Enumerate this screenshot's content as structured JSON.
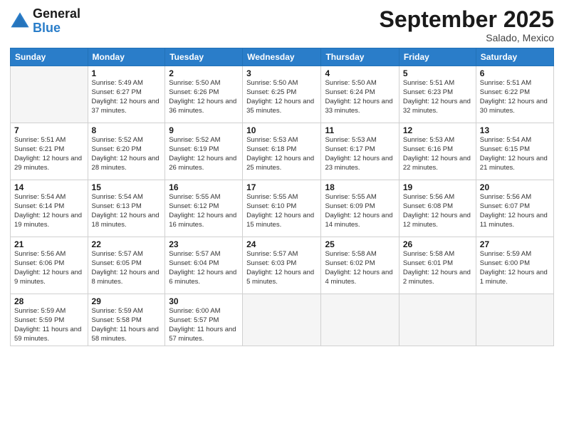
{
  "header": {
    "logo_general": "General",
    "logo_blue": "Blue",
    "month_title": "September 2025",
    "subtitle": "Salado, Mexico"
  },
  "weekdays": [
    "Sunday",
    "Monday",
    "Tuesday",
    "Wednesday",
    "Thursday",
    "Friday",
    "Saturday"
  ],
  "weeks": [
    [
      {
        "day": "",
        "info": ""
      },
      {
        "day": "1",
        "info": "Sunrise: 5:49 AM\nSunset: 6:27 PM\nDaylight: 12 hours\nand 37 minutes."
      },
      {
        "day": "2",
        "info": "Sunrise: 5:50 AM\nSunset: 6:26 PM\nDaylight: 12 hours\nand 36 minutes."
      },
      {
        "day": "3",
        "info": "Sunrise: 5:50 AM\nSunset: 6:25 PM\nDaylight: 12 hours\nand 35 minutes."
      },
      {
        "day": "4",
        "info": "Sunrise: 5:50 AM\nSunset: 6:24 PM\nDaylight: 12 hours\nand 33 minutes."
      },
      {
        "day": "5",
        "info": "Sunrise: 5:51 AM\nSunset: 6:23 PM\nDaylight: 12 hours\nand 32 minutes."
      },
      {
        "day": "6",
        "info": "Sunrise: 5:51 AM\nSunset: 6:22 PM\nDaylight: 12 hours\nand 30 minutes."
      }
    ],
    [
      {
        "day": "7",
        "info": "Sunrise: 5:51 AM\nSunset: 6:21 PM\nDaylight: 12 hours\nand 29 minutes."
      },
      {
        "day": "8",
        "info": "Sunrise: 5:52 AM\nSunset: 6:20 PM\nDaylight: 12 hours\nand 28 minutes."
      },
      {
        "day": "9",
        "info": "Sunrise: 5:52 AM\nSunset: 6:19 PM\nDaylight: 12 hours\nand 26 minutes."
      },
      {
        "day": "10",
        "info": "Sunrise: 5:53 AM\nSunset: 6:18 PM\nDaylight: 12 hours\nand 25 minutes."
      },
      {
        "day": "11",
        "info": "Sunrise: 5:53 AM\nSunset: 6:17 PM\nDaylight: 12 hours\nand 23 minutes."
      },
      {
        "day": "12",
        "info": "Sunrise: 5:53 AM\nSunset: 6:16 PM\nDaylight: 12 hours\nand 22 minutes."
      },
      {
        "day": "13",
        "info": "Sunrise: 5:54 AM\nSunset: 6:15 PM\nDaylight: 12 hours\nand 21 minutes."
      }
    ],
    [
      {
        "day": "14",
        "info": "Sunrise: 5:54 AM\nSunset: 6:14 PM\nDaylight: 12 hours\nand 19 minutes."
      },
      {
        "day": "15",
        "info": "Sunrise: 5:54 AM\nSunset: 6:13 PM\nDaylight: 12 hours\nand 18 minutes."
      },
      {
        "day": "16",
        "info": "Sunrise: 5:55 AM\nSunset: 6:12 PM\nDaylight: 12 hours\nand 16 minutes."
      },
      {
        "day": "17",
        "info": "Sunrise: 5:55 AM\nSunset: 6:10 PM\nDaylight: 12 hours\nand 15 minutes."
      },
      {
        "day": "18",
        "info": "Sunrise: 5:55 AM\nSunset: 6:09 PM\nDaylight: 12 hours\nand 14 minutes."
      },
      {
        "day": "19",
        "info": "Sunrise: 5:56 AM\nSunset: 6:08 PM\nDaylight: 12 hours\nand 12 minutes."
      },
      {
        "day": "20",
        "info": "Sunrise: 5:56 AM\nSunset: 6:07 PM\nDaylight: 12 hours\nand 11 minutes."
      }
    ],
    [
      {
        "day": "21",
        "info": "Sunrise: 5:56 AM\nSunset: 6:06 PM\nDaylight: 12 hours\nand 9 minutes."
      },
      {
        "day": "22",
        "info": "Sunrise: 5:57 AM\nSunset: 6:05 PM\nDaylight: 12 hours\nand 8 minutes."
      },
      {
        "day": "23",
        "info": "Sunrise: 5:57 AM\nSunset: 6:04 PM\nDaylight: 12 hours\nand 6 minutes."
      },
      {
        "day": "24",
        "info": "Sunrise: 5:57 AM\nSunset: 6:03 PM\nDaylight: 12 hours\nand 5 minutes."
      },
      {
        "day": "25",
        "info": "Sunrise: 5:58 AM\nSunset: 6:02 PM\nDaylight: 12 hours\nand 4 minutes."
      },
      {
        "day": "26",
        "info": "Sunrise: 5:58 AM\nSunset: 6:01 PM\nDaylight: 12 hours\nand 2 minutes."
      },
      {
        "day": "27",
        "info": "Sunrise: 5:59 AM\nSunset: 6:00 PM\nDaylight: 12 hours\nand 1 minute."
      }
    ],
    [
      {
        "day": "28",
        "info": "Sunrise: 5:59 AM\nSunset: 5:59 PM\nDaylight: 11 hours\nand 59 minutes."
      },
      {
        "day": "29",
        "info": "Sunrise: 5:59 AM\nSunset: 5:58 PM\nDaylight: 11 hours\nand 58 minutes."
      },
      {
        "day": "30",
        "info": "Sunrise: 6:00 AM\nSunset: 5:57 PM\nDaylight: 11 hours\nand 57 minutes."
      },
      {
        "day": "",
        "info": ""
      },
      {
        "day": "",
        "info": ""
      },
      {
        "day": "",
        "info": ""
      },
      {
        "day": "",
        "info": ""
      }
    ]
  ]
}
